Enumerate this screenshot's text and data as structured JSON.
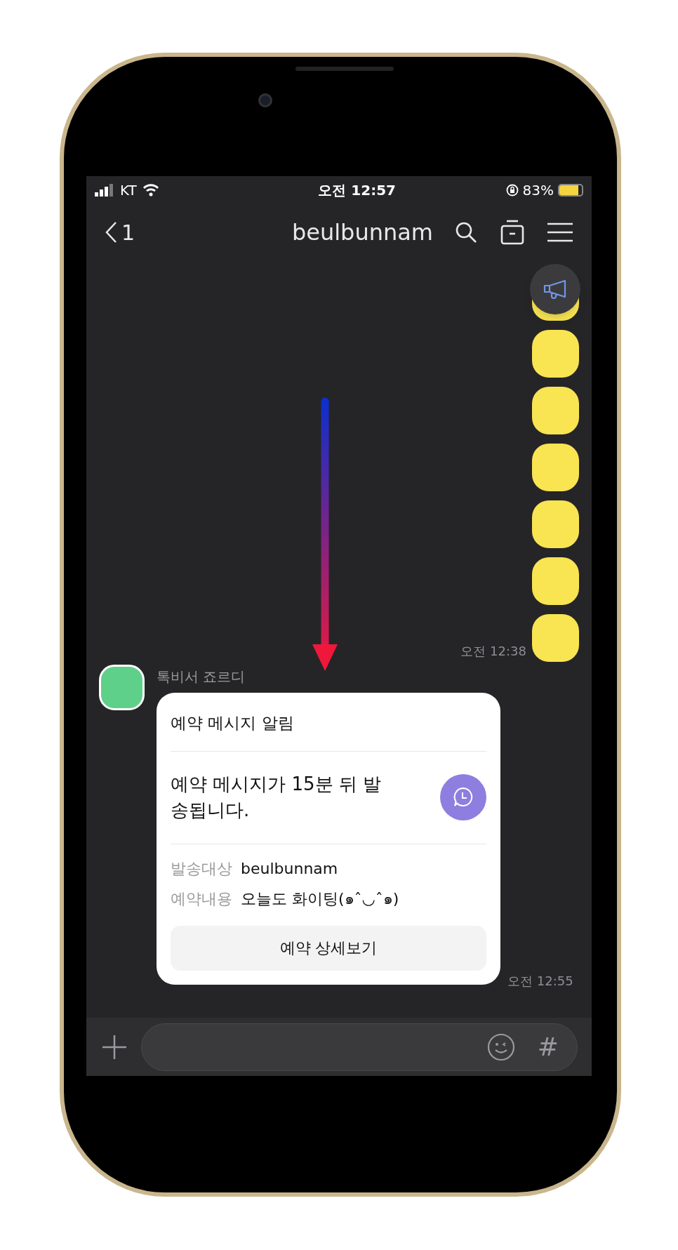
{
  "status_bar": {
    "carrier": "KT",
    "time": "오전 12:57",
    "battery_percent": "83%",
    "battery": {
      "level": 0.83
    }
  },
  "header": {
    "back_count": "1",
    "title": "beulbunnam"
  },
  "outgoing": {
    "messages": [
      {
        "kind": "blank"
      },
      {
        "kind": "blank"
      },
      {
        "kind": "blank"
      },
      {
        "kind": "blank"
      },
      {
        "kind": "blank"
      },
      {
        "kind": "blank"
      },
      {
        "kind": "blank"
      }
    ],
    "time": "오전 12:38"
  },
  "incoming": {
    "sender": "톡비서 죠르디",
    "card": {
      "title": "예약 메시지 알림",
      "message": "예약 메시지가 15분 뒤 발송됩니다.",
      "rows": [
        {
          "label": "발송대상",
          "value": "beulbunnam"
        },
        {
          "label": "예약내용",
          "value": "오늘도 화이팅(๑ˆ◡ˆ๑)"
        }
      ],
      "button": "예약 상세보기"
    },
    "time": "오전 12:55"
  },
  "input_bar": {
    "hash": "#"
  }
}
